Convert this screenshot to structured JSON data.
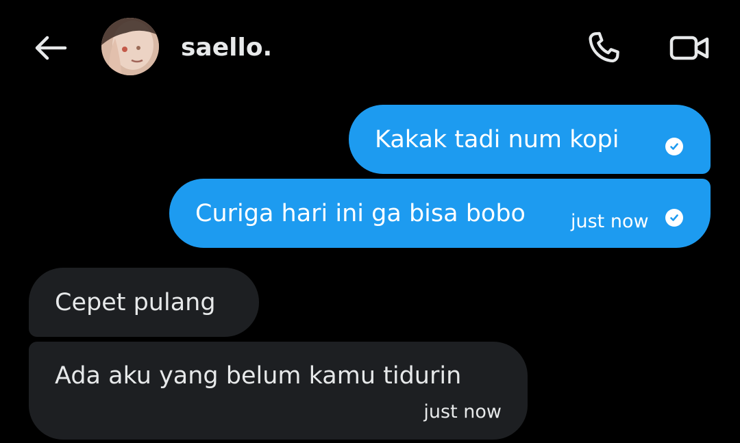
{
  "header": {
    "back_icon": "arrow-left-icon",
    "contact_name": "saello.",
    "call_icon": "phone-icon",
    "video_icon": "video-camera-icon"
  },
  "messages": [
    {
      "direction": "outgoing",
      "text": "Kakak tadi num kopi",
      "time": "",
      "status_icon": "check-circle-icon"
    },
    {
      "direction": "outgoing",
      "text": "Curiga hari ini ga bisa bobo",
      "time": "just now",
      "status_icon": "check-circle-icon"
    },
    {
      "direction": "incoming",
      "text": "Cepet pulang",
      "time": ""
    },
    {
      "direction": "incoming",
      "text": "Ada aku yang belum kamu tidurin",
      "time": "just now"
    }
  ],
  "colors": {
    "background": "#000000",
    "outgoing_bubble": "#1d9bf0",
    "incoming_bubble": "#1d1f22",
    "text": "#e7e9ea"
  }
}
